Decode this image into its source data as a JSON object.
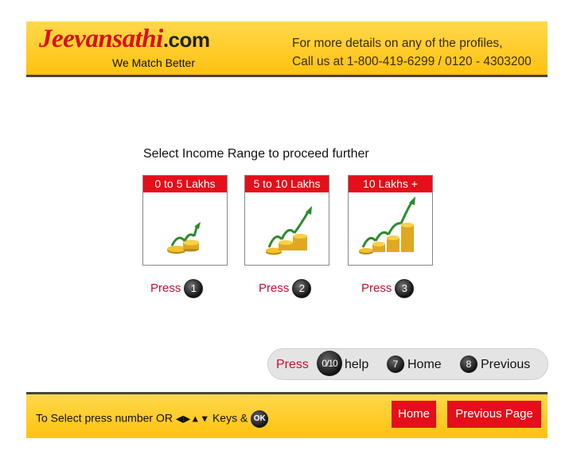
{
  "header": {
    "logo_main": "Jeevansathi",
    "logo_suffix": ".com",
    "tagline": "We Match Better",
    "contact_line1": "For more details on any of the profiles,",
    "contact_line2": "Call us at 1-800-419-6299 / 0120 - 4303200"
  },
  "main": {
    "prompt": "Select Income Range to proceed further",
    "options": [
      {
        "label": "0 to 5 Lakhs",
        "press": "Press",
        "key": "1",
        "icon": "small-coin-growth-icon"
      },
      {
        "label": "5 to 10 Lakhs",
        "press": "Press",
        "key": "2",
        "icon": "medium-coin-growth-icon"
      },
      {
        "label": "10 Lakhs +",
        "press": "Press",
        "key": "3",
        "icon": "large-coin-growth-icon"
      }
    ]
  },
  "helpbar": {
    "press": "Press",
    "help_key": "0/10",
    "help_label": "help",
    "home_key": "7",
    "home_label": "Home",
    "prev_key": "8",
    "prev_label": "Previous"
  },
  "footer": {
    "instr_prefix": "To Select press number OR",
    "arrows": "◀▶▲▼",
    "instr_suffix": "Keys &",
    "ok": "OK",
    "home_button": "Home",
    "previous_button": "Previous Page"
  },
  "colors": {
    "accent_red": "#e40f1a",
    "header_yellow": "#ffc20f",
    "press_red": "#c8102e"
  }
}
